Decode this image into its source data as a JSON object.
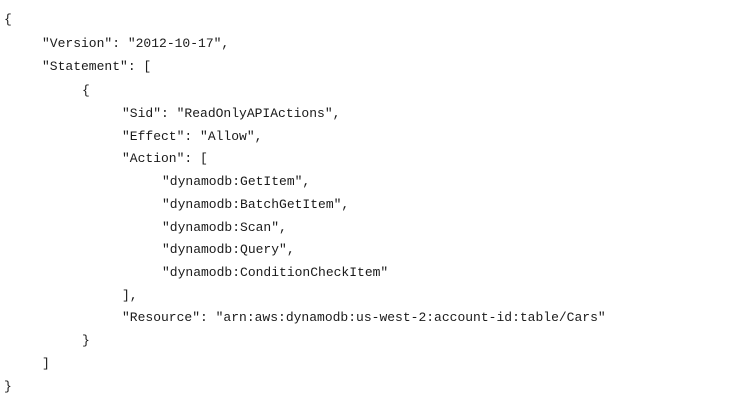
{
  "document": {
    "lines": [
      "{",
      "\"Version\": \"2012-10-17\",",
      "\"Statement\": [",
      "{",
      "\"Sid\": \"ReadOnlyAPIActions\",",
      "\"Effect\": \"Allow\",",
      "\"Action\": [",
      "\"dynamodb:GetItem\",",
      "\"dynamodb:BatchGetItem\",",
      "\"dynamodb:Scan\",",
      "\"dynamodb:Query\",",
      "\"dynamodb:ConditionCheckItem\"",
      "],",
      "\"Resource\": \"arn:aws:dynamodb:us-west-2:account-id:table/Cars\"",
      "}",
      "]",
      "}"
    ]
  }
}
